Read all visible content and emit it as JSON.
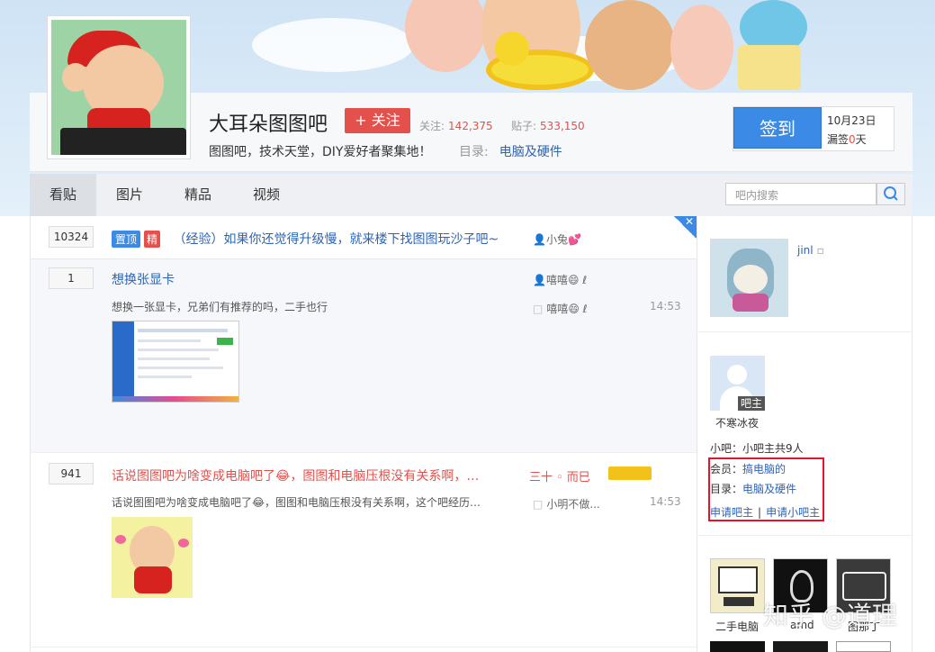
{
  "forum": {
    "name": "大耳朵图图吧",
    "follow_label": "+ 关注",
    "follow_count_label": "关注:",
    "follow_count": "142,375",
    "post_count_label": "贴子:",
    "post_count": "533,150",
    "slogan": "图图吧，技术天堂，DIY爱好者聚集地！",
    "catalog_label": "目录:",
    "catalog_value": "电脑及硬件"
  },
  "signin": {
    "button_label": "签到",
    "date": "10月23日",
    "missed_prefix": "漏签",
    "missed_days": "0",
    "missed_suffix": "天"
  },
  "nav": {
    "tabs": [
      "看贴",
      "图片",
      "精品",
      "视频"
    ],
    "active": "看贴",
    "search_placeholder": "吧内搜索"
  },
  "threads": [
    {
      "replies": "10324",
      "badges": [
        "置顶",
        "精"
      ],
      "title": "（经验）如果你还觉得升级慢，就来楼下找图图玩沙子吧~",
      "author": "小兔💕"
    },
    {
      "replies": "1",
      "title": "想换张显卡",
      "author": "嘻嘻😄 ℓ",
      "abstract": "想换一张显卡，兄弟们有推荐的吗，二手也行",
      "last_reply": "嘻嘻😄 ℓ",
      "time": "14:53"
    },
    {
      "replies": "941",
      "title": "话说图图吧为啥变成电脑吧了😂，图图和电脑压根没有关系啊，…",
      "author": "三十 ◦ 而巳",
      "abstract": "话说图图吧为啥变成电脑吧了😂，图图和电脑压根没有关系啊，这个吧经历…",
      "last_reply": "小明不做...",
      "time": "14:53"
    }
  ],
  "sidebar": {
    "user_name": "jinl",
    "manager_tag": "吧主",
    "manager_name": "不寒冰夜",
    "sub_manager": "小吧：小吧主共9人",
    "member_label": "会员：",
    "member_value": "搞电脑的",
    "catalog_label": "目录：",
    "catalog_value": "电脑及硬件",
    "apply_manager": "申请吧主",
    "apply_sub": "申请小吧主",
    "related": [
      "二手电脑",
      "amd",
      "图那丁"
    ]
  },
  "watermark": "知乎 @道理"
}
